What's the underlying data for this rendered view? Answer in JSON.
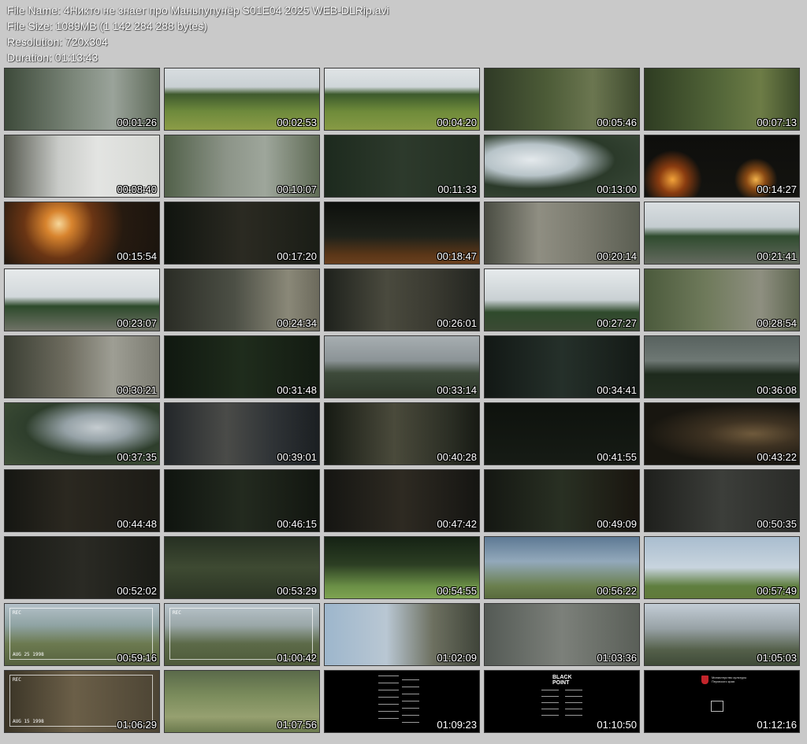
{
  "header": {
    "file_name": "File Name: 4Никто не знает про Маньпупунёр S01E04 2025 WEB-DLRip.avi",
    "file_size": "File Size: 1089MB (1 142 284 288 bytes)",
    "resolution": "Resolution: 720x304",
    "duration": "Duration: 01:13:43"
  },
  "thumbnails": [
    {
      "time": "00:01:26",
      "scene": "forest-mist"
    },
    {
      "time": "00:02:53",
      "scene": "meadow-two"
    },
    {
      "time": "00:04:20",
      "scene": "meadow-camera"
    },
    {
      "time": "00:05:46",
      "scene": "forest-hikers"
    },
    {
      "time": "00:07:13",
      "scene": "forest-woman"
    },
    {
      "time": "00:08:40",
      "scene": "grey-sky-man"
    },
    {
      "time": "00:10:07",
      "scene": "forest-couple"
    },
    {
      "time": "00:11:33",
      "scene": "dark-green-man"
    },
    {
      "time": "00:13:00",
      "scene": "branches-sky"
    },
    {
      "time": "00:14:27",
      "scene": "night-fires"
    },
    {
      "time": "00:15:54",
      "scene": "fire-closeup"
    },
    {
      "time": "00:17:20",
      "scene": "dark-profile"
    },
    {
      "time": "00:18:47",
      "scene": "dark-man-orange"
    },
    {
      "time": "00:20:14",
      "scene": "old-man-hat"
    },
    {
      "time": "00:21:41",
      "scene": "rock-sitting"
    },
    {
      "time": "00:23:07",
      "scene": "arms-open"
    },
    {
      "time": "00:24:34",
      "scene": "man-looking"
    },
    {
      "time": "00:26:01",
      "scene": "two-faces"
    },
    {
      "time": "00:27:27",
      "scene": "two-men-sky"
    },
    {
      "time": "00:28:54",
      "scene": "two-men-rocks"
    },
    {
      "time": "00:30:21",
      "scene": "old-man-rocks"
    },
    {
      "time": "00:31:48",
      "scene": "dark-forest-two"
    },
    {
      "time": "00:33:14",
      "scene": "landscape-rocks"
    },
    {
      "time": "00:34:41",
      "scene": "dark-couple"
    },
    {
      "time": "00:36:08",
      "scene": "dusk-landscape"
    },
    {
      "time": "00:37:35",
      "scene": "branches-sky2"
    },
    {
      "time": "00:39:01",
      "scene": "hand-dark"
    },
    {
      "time": "00:40:28",
      "scene": "old-man-dark"
    },
    {
      "time": "00:41:55",
      "scene": "very-dark"
    },
    {
      "time": "00:43:22",
      "scene": "dark-warm"
    },
    {
      "time": "00:44:48",
      "scene": "cabin-interior"
    },
    {
      "time": "00:46:15",
      "scene": "dark-group"
    },
    {
      "time": "00:47:42",
      "scene": "dark-man-center"
    },
    {
      "time": "00:49:09",
      "scene": "dark-man-side"
    },
    {
      "time": "00:50:35",
      "scene": "old-man-grey"
    },
    {
      "time": "00:52:02",
      "scene": "dark-wall"
    },
    {
      "time": "00:53:29",
      "scene": "ground-object"
    },
    {
      "time": "00:54:55",
      "scene": "upside-forest"
    },
    {
      "time": "00:56:22",
      "scene": "man-head-hand"
    },
    {
      "time": "00:57:49",
      "scene": "three-people"
    },
    {
      "time": "00:59:16",
      "scene": "vhs-selfie"
    },
    {
      "time": "01:00:42",
      "scene": "vhs-group"
    },
    {
      "time": "01:02:09",
      "scene": "rock-pillars"
    },
    {
      "time": "01:03:36",
      "scene": "man-crying"
    },
    {
      "time": "01:05:03",
      "scene": "two-dancing"
    },
    {
      "time": "01:06:29",
      "scene": "vhs-indoor"
    },
    {
      "time": "01:07:56",
      "scene": "aerial-pillars"
    },
    {
      "time": "01:09:23",
      "scene": "credits-list"
    },
    {
      "time": "01:10:50",
      "scene": "credits-logo"
    },
    {
      "time": "01:12:16",
      "scene": "credits-emblem"
    }
  ],
  "vhs": {
    "rec": "REC",
    "date1": "AUG 25 1998",
    "date2": "AUG 15 1998"
  },
  "credits": {
    "logo": "BLACK POINT",
    "ministry": "Министерство культуры Пермского края"
  }
}
